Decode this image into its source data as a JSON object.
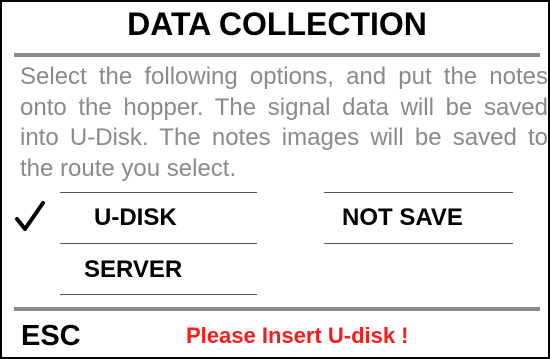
{
  "screen": {
    "title": "DATA COLLECTION",
    "description": "Select the following options, and put the notes onto the hopper. The  signal  data will be saved into U-Disk. The notes images will be saved to the route you select."
  },
  "options": {
    "udisk_label": "U-DISK",
    "not_save_label": "NOT SAVE",
    "server_label": "SERVER",
    "selected": "U-DISK"
  },
  "footer": {
    "esc_label": "ESC",
    "warning_text": "Please Insert U-disk",
    "warning_mark": "!"
  },
  "colors": {
    "title": "#000000",
    "description": "#8a8a8a",
    "rule": "#8a8a8a",
    "warning": "#ff1a1a"
  },
  "icons": {
    "selected_marker": "checkmark-icon"
  }
}
